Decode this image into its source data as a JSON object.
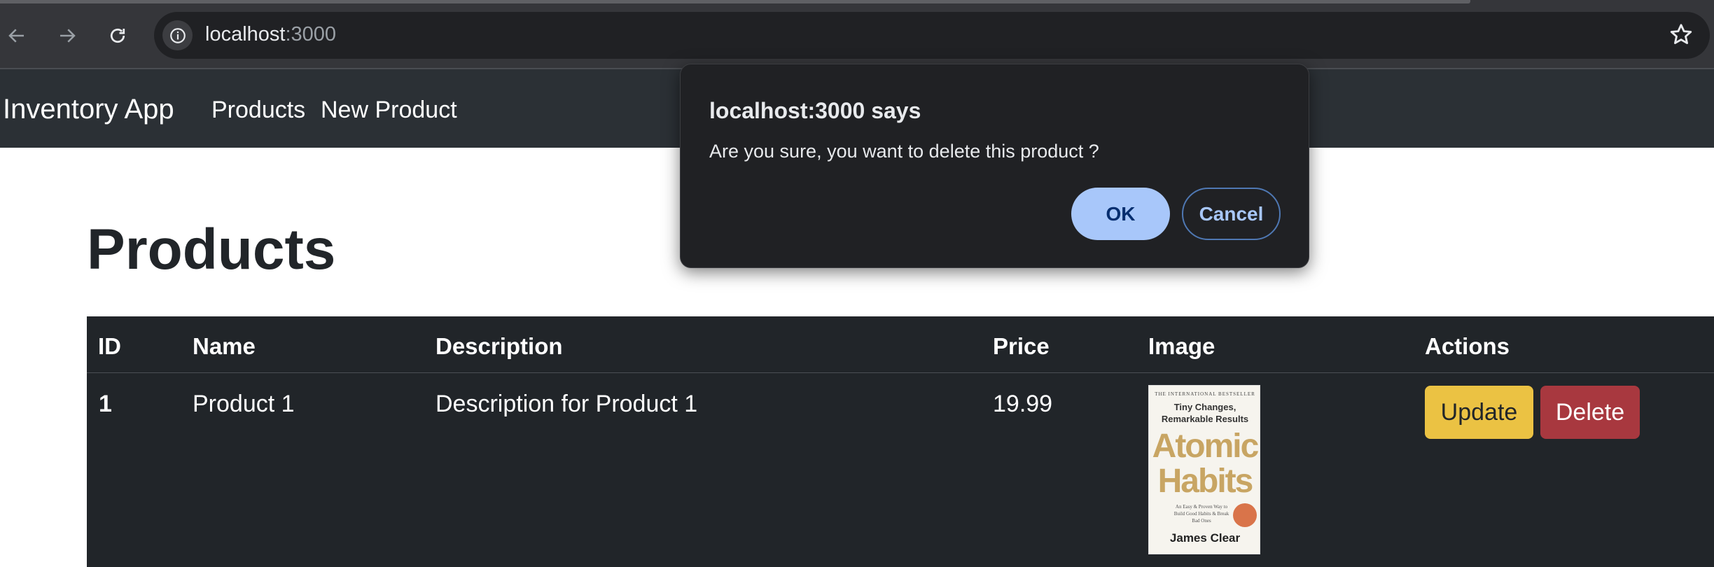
{
  "browser": {
    "url_host": "localhost",
    "url_port": ":3000",
    "icons": [
      "back-icon",
      "forward-icon",
      "reload-icon",
      "info-icon",
      "star-icon"
    ]
  },
  "navbar": {
    "brand": "Inventory App",
    "links": [
      "Products",
      "New Product"
    ]
  },
  "page": {
    "title": "Products"
  },
  "table": {
    "headers": [
      "ID",
      "Name",
      "Description",
      "Price",
      "Image",
      "Actions"
    ],
    "rows": [
      {
        "id": "1",
        "name": "Product 1",
        "description": "Description for Product 1",
        "price": "19.99",
        "image": {
          "kicker": "THE INTERNATIONAL BESTSELLER",
          "tagline_1": "Tiny Changes,",
          "tagline_2": "Remarkable Results",
          "title_1": "Atomic",
          "title_2": "Habits",
          "subtitle": "An Easy & Proven Way to Build Good Habits & Break Bad Ones",
          "author": "James Clear"
        },
        "update_label": "Update",
        "delete_label": "Delete"
      }
    ]
  },
  "dialog": {
    "title": "localhost:3000 says",
    "message": "Are you sure, you want to delete this product ?",
    "ok_label": "OK",
    "cancel_label": "Cancel"
  },
  "colors": {
    "navbar_bg": "#2b3035",
    "table_bg": "#212529",
    "update_btn": "#ebc243",
    "delete_btn": "#a8383f",
    "dialog_ok": "#a8c7fa"
  }
}
